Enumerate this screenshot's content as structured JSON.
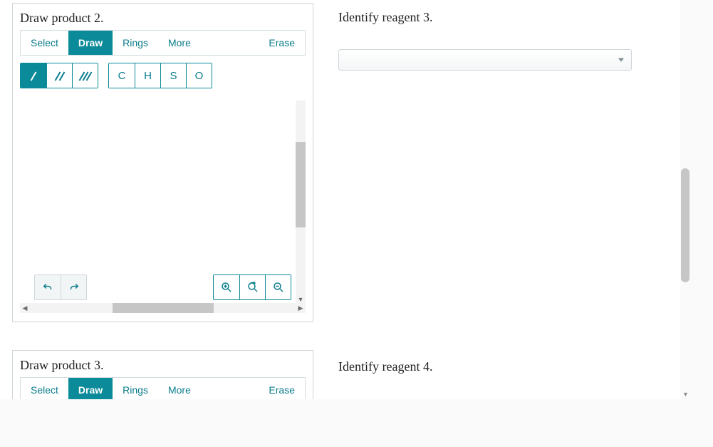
{
  "colors": {
    "accent": "#0b8a99",
    "border": "#cfd6d9",
    "text": "#222"
  },
  "panel2": {
    "title": "Draw product 2.",
    "tabs": {
      "select": "Select",
      "draw": "Draw",
      "rings": "Rings",
      "more": "More",
      "erase": "Erase"
    },
    "atoms": {
      "c": "C",
      "h": "H",
      "s": "S",
      "o": "O"
    }
  },
  "panel3": {
    "title": "Draw product 3.",
    "tabs": {
      "select": "Select",
      "draw": "Draw",
      "rings": "Rings",
      "more": "More",
      "erase": "Erase"
    }
  },
  "right": {
    "reagent3": "Identify reagent 3.",
    "reagent4": "Identify reagent 4.",
    "placeholder": ""
  }
}
